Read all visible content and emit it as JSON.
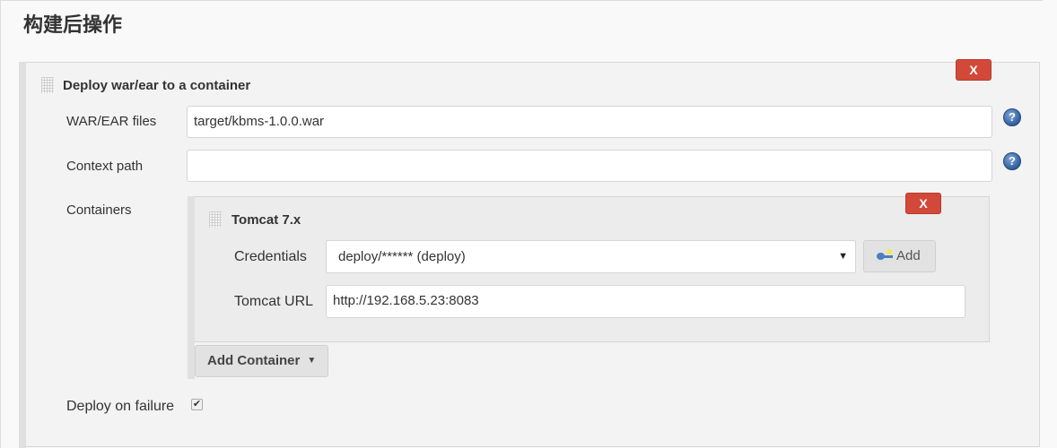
{
  "section": {
    "title": "构建后操作"
  },
  "deploy_step": {
    "title": "Deploy war/ear to a container",
    "delete_label": "X",
    "fields": {
      "war_files": {
        "label": "WAR/EAR files",
        "value": "target/kbms-1.0.0.war",
        "help": "?"
      },
      "context_path": {
        "label": "Context path",
        "value": "",
        "help": "?"
      },
      "containers_label": "Containers",
      "deploy_on_failure": {
        "label": "Deploy on failure",
        "checked": true,
        "check_glyph": "✔"
      }
    },
    "container": {
      "title": "Tomcat 7.x",
      "delete_label": "X",
      "credentials": {
        "label": "Credentials",
        "selected": "deploy/****** (deploy)",
        "arrow": "▼",
        "add_label": "Add"
      },
      "tomcat_url": {
        "label": "Tomcat URL",
        "value": "http://192.168.5.23:8083"
      }
    },
    "add_container": {
      "label": "Add Container",
      "caret": "▼"
    }
  },
  "colors": {
    "danger": "#d24939",
    "help_icon": "#2f5f9f"
  }
}
